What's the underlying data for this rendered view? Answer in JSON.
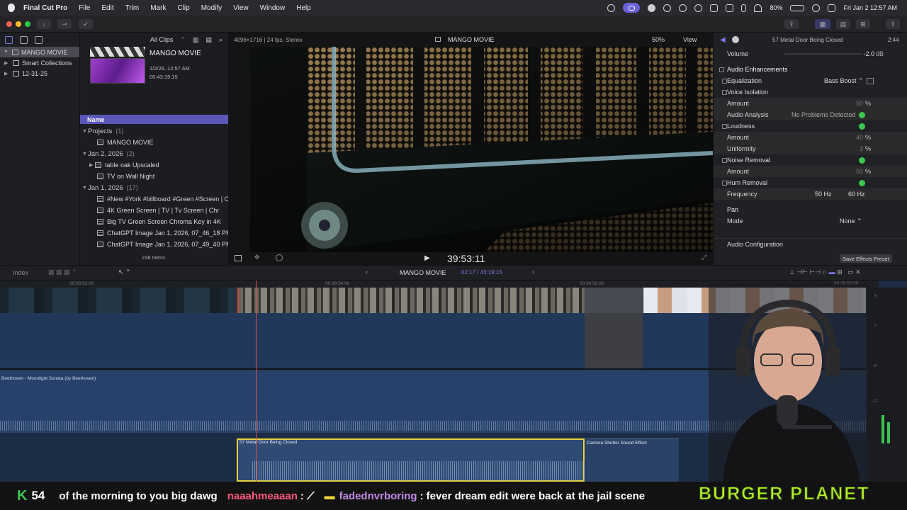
{
  "menubar": {
    "app": "Final Cut Pro",
    "items": [
      "File",
      "Edit",
      "Trim",
      "Mark",
      "Clip",
      "Modify",
      "View",
      "Window",
      "Help"
    ],
    "battery": "80%",
    "datetime": "Fri Jan 2  12:57 AM"
  },
  "library": {
    "items": [
      {
        "label": "MANGO MOVIE",
        "expanded": true
      },
      {
        "label": "Smart Collections"
      },
      {
        "label": "12-31-25"
      }
    ]
  },
  "browser": {
    "filter": "All Clips",
    "project_title": "MANGO MOVIE",
    "project_date": "1/2/26, 12:57 AM",
    "project_duration": "00:43:19:15",
    "column_name": "Name",
    "groups": [
      {
        "label": "Projects",
        "count": "(1)",
        "items": [
          "MANGO MOVIE"
        ]
      },
      {
        "label": "Jan 2, 2026",
        "count": "(2)",
        "items": [
          "table oak Upscaled",
          "TV on Wall Night"
        ]
      },
      {
        "label": "Jan 1, 2026",
        "count": "(17)",
        "items": [
          "#New #York #billboard #Green #Screen | C",
          "4K Green Screen  |  TV  |  Tv Screen  |  Chr",
          "Big TV Green Screen Chroma Key in 4K",
          "ChatGPT Image Jan 1, 2026, 07_46_18 PM",
          "ChatGPT Image Jan 1, 2026, 07_49_40 PM"
        ]
      }
    ],
    "count": "238 Items"
  },
  "viewer": {
    "format": "4096×1716 | 24 fps, Stereo",
    "title": "MANGO MOVIE",
    "zoom": "50%",
    "view_menu": "View",
    "timecode": "39:53:11"
  },
  "inspector": {
    "clip": "57 Metal Door Being Closed",
    "duration": "2:44",
    "volume_label": "Volume",
    "volume_value": "-2.0",
    "volume_unit": "dB",
    "section": "Audio Enhancements",
    "rows": [
      {
        "label": "Equalization",
        "value": "Bass Boost ⌃",
        "cb": true
      },
      {
        "label": "Voice Isolation",
        "cb": true
      },
      {
        "label": "Amount",
        "value": "50",
        "unit": "%",
        "sub": true
      },
      {
        "label": "Audio Analysis",
        "value": "No Problems Detected",
        "check": true,
        "sub": true
      },
      {
        "label": "Loudness",
        "cb": true,
        "check": true
      },
      {
        "label": "Amount",
        "value": "40",
        "unit": "%",
        "sub": true
      },
      {
        "label": "Uniformity",
        "value": "3",
        "unit": "%",
        "sub": true
      },
      {
        "label": "Noise Removal",
        "cb": true,
        "check": true
      },
      {
        "label": "Amount",
        "value": "50",
        "unit": "%",
        "sub": true
      },
      {
        "label": "Hum Removal",
        "cb": true,
        "check": true
      },
      {
        "label": "Frequency",
        "value": "50 Hz",
        "value2": "60 Hz",
        "sub": true
      }
    ],
    "pan": "Pan",
    "pan_mode_label": "Mode",
    "pan_mode_value": "None ⌃",
    "audio_config": "Audio Configuration",
    "save_preset": "Save Effects Preset"
  },
  "timeline": {
    "index": "Index",
    "project": "MANGO MOVIE",
    "position": "02:17 / 43:19:15",
    "ruler": [
      "00:39:52:00",
      "00:39:54:00",
      "00:39:56:00",
      "00:39:58:00"
    ],
    "music_label": "Beethoven - Moonlight Sonata (by Beethoven)",
    "clip_a": "57 Metal Door Being Closed",
    "clip_b": "Camera Shutter Sound Effect",
    "meter_labels": [
      "6",
      "0",
      "-6",
      "-12"
    ]
  },
  "stream": {
    "k_count": "54",
    "message1": "of the morning to you big dawg",
    "user2": "naaahmeaaan",
    "user3": "fadednvrboring",
    "message3": "fever dream edit were back at the jail scene",
    "banner": "BURGER PLANET"
  },
  "colors": {
    "accent": "#6a62d8",
    "clip_blue": "#2f4a73",
    "yellow": "#e8d23c",
    "green": "#3cc550",
    "purple_user": "#c28ae6",
    "red_user": "#ff5a7a",
    "banner": "#b8f02a"
  }
}
